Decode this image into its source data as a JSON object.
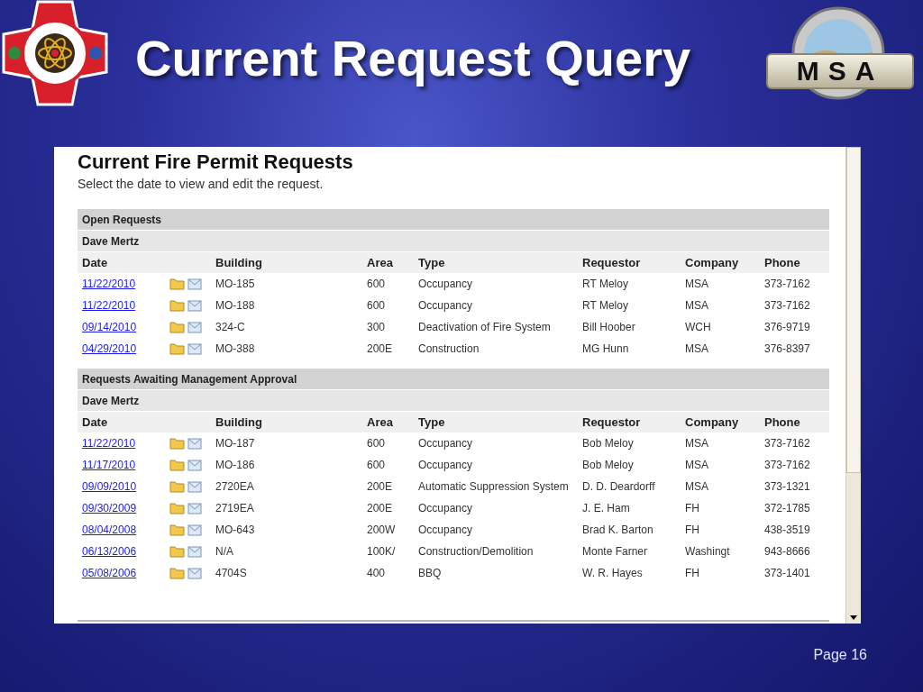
{
  "slide": {
    "title": "Current Request Query",
    "logo_text": "MSA",
    "page": "Page 16"
  },
  "page": {
    "heading": "Current Fire Permit Requests",
    "subtitle": "Select the date to view and edit the request.",
    "sections": [
      {
        "title": "Open Requests",
        "group": "Dave Mertz",
        "columns": [
          "Date",
          "Building",
          "Area",
          "Type",
          "Requestor",
          "Company",
          "Phone"
        ],
        "rows": [
          {
            "date": "11/22/2010",
            "building": "MO-185",
            "area": "600",
            "type": "Occupancy",
            "requestor": "RT Meloy",
            "company": "MSA",
            "phone": "373-7162"
          },
          {
            "date": "11/22/2010",
            "building": "MO-188",
            "area": "600",
            "type": "Occupancy",
            "requestor": "RT Meloy",
            "company": "MSA",
            "phone": "373-7162"
          },
          {
            "date": "09/14/2010",
            "building": "324-C",
            "area": "300",
            "type": "Deactivation of Fire System",
            "requestor": "Bill Hoober",
            "company": "WCH",
            "phone": "376-9719"
          },
          {
            "date": "04/29/2010",
            "building": "MO-388",
            "area": "200E",
            "type": "Construction",
            "requestor": "MG Hunn",
            "company": "MSA",
            "phone": "376-8397"
          }
        ]
      },
      {
        "title": "Requests Awaiting Management Approval",
        "group": "Dave Mertz",
        "columns": [
          "Date",
          "Building",
          "Area",
          "Type",
          "Requestor",
          "Company",
          "Phone"
        ],
        "rows": [
          {
            "date": "11/22/2010",
            "building": "MO-187",
            "area": "600",
            "type": "Occupancy",
            "requestor": "Bob Meloy",
            "company": "MSA",
            "phone": "373-7162"
          },
          {
            "date": "11/17/2010",
            "building": "MO-186",
            "area": "600",
            "type": "Occupancy",
            "requestor": "Bob Meloy",
            "company": "MSA",
            "phone": "373-7162"
          },
          {
            "date": "09/09/2010",
            "building": "2720EA",
            "area": "200E",
            "type": "Automatic Suppression System",
            "requestor": "D. D. Deardorff",
            "company": "MSA",
            "phone": "373-1321"
          },
          {
            "date": "09/30/2009",
            "building": "2719EA",
            "area": "200E",
            "type": "Occupancy",
            "requestor": "J. E. Ham",
            "company": "FH",
            "phone": "372-1785"
          },
          {
            "date": "08/04/2008",
            "building": "MO-643",
            "area": "200W",
            "type": "Occupancy",
            "requestor": "Brad K. Barton",
            "company": "FH",
            "phone": "438-3519"
          },
          {
            "date": "06/13/2006",
            "building": "N/A",
            "area": "100K/",
            "type": "Construction/Demolition",
            "requestor": "Monte Farner",
            "company": "Washingt",
            "phone": "943-8666"
          },
          {
            "date": "05/08/2006",
            "building": "4704S",
            "area": "400",
            "type": "BBQ",
            "requestor": "W. R. Hayes",
            "company": "FH",
            "phone": "373-1401"
          }
        ]
      }
    ]
  }
}
